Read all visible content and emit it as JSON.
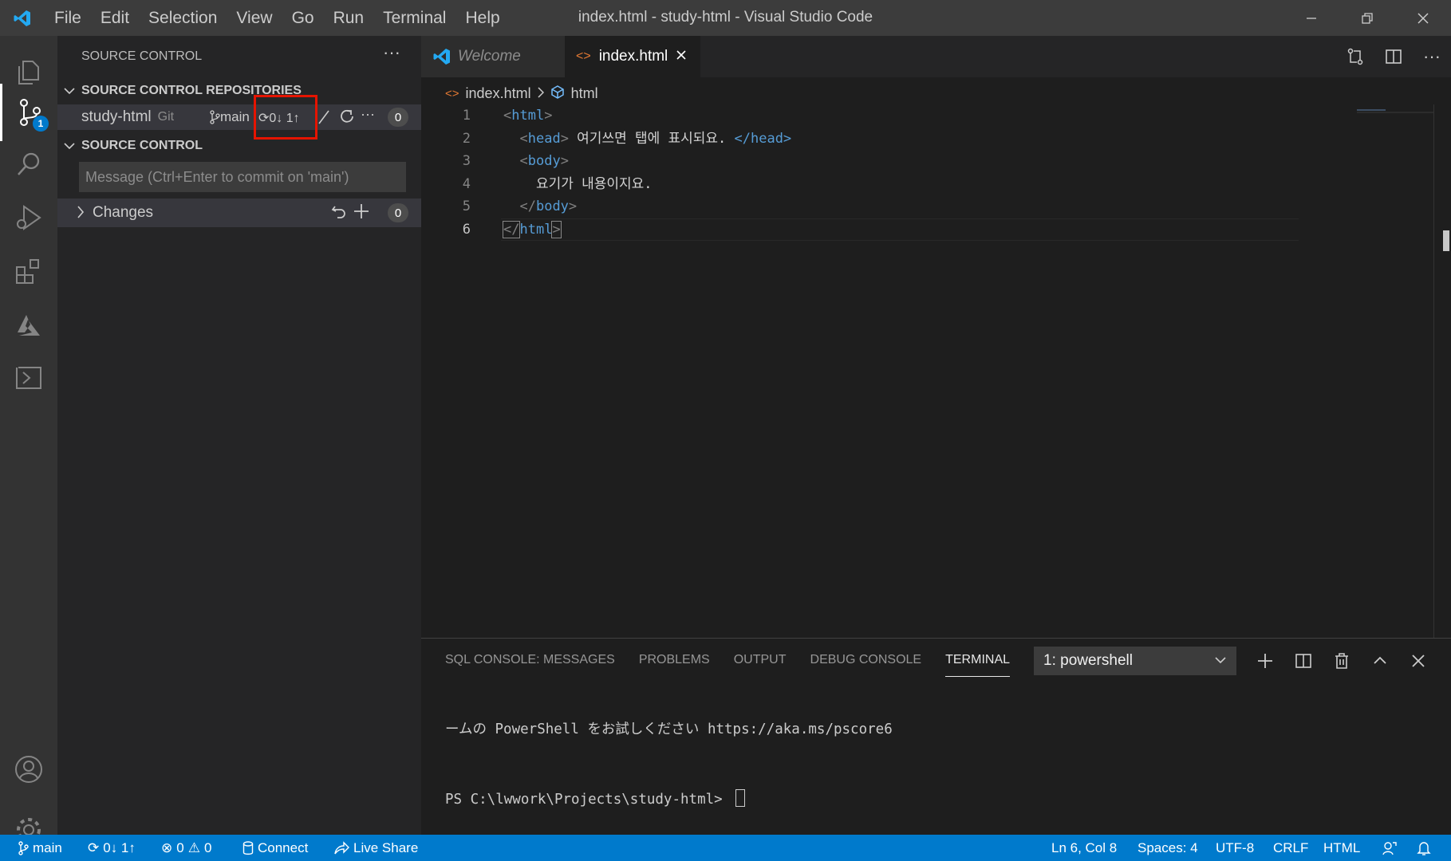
{
  "window": {
    "title": "index.html - study-html - Visual Studio Code",
    "menu": [
      "File",
      "Edit",
      "Selection",
      "View",
      "Go",
      "Run",
      "Terminal",
      "Help"
    ]
  },
  "activity_bar": {
    "scm_badge": "1"
  },
  "sidebar": {
    "header": "SOURCE CONTROL",
    "repos_section": "SOURCE CONTROL REPOSITORIES",
    "repo": {
      "name": "study-html",
      "kind": "Git",
      "branch": "main",
      "sync": "0↓ 1↑",
      "count": "0"
    },
    "scm_section": "SOURCE CONTROL",
    "commit_placeholder": "Message (Ctrl+Enter to commit on 'main')",
    "changes": {
      "label": "Changes",
      "count": "0"
    }
  },
  "editor": {
    "tabs": [
      {
        "label": "Welcome",
        "active": false
      },
      {
        "label": "index.html",
        "active": true
      }
    ],
    "breadcrumb": {
      "file": "index.html",
      "symbol": "html"
    },
    "lines": [
      {
        "num": "1",
        "indent": "",
        "open": "<",
        "tag": "html",
        "close": ">",
        "text": "",
        "endtag": ""
      },
      {
        "num": "2",
        "indent": "  ",
        "open": "<",
        "tag": "head",
        "close": ">",
        "text": " 여기쓰면 탭에 표시되요. ",
        "endtag": "</head>"
      },
      {
        "num": "3",
        "indent": "  ",
        "open": "<",
        "tag": "body",
        "close": ">",
        "text": "",
        "endtag": ""
      },
      {
        "num": "4",
        "indent": "    ",
        "open": "",
        "tag": "",
        "close": "",
        "text": "요기가 내용이지요.",
        "endtag": ""
      },
      {
        "num": "5",
        "indent": "  ",
        "open": "</",
        "tag": "body",
        "close": ">",
        "text": "",
        "endtag": ""
      },
      {
        "num": "6",
        "indent": "",
        "open": "</",
        "tag": "html",
        "close": ">",
        "text": "",
        "endtag": ""
      }
    ]
  },
  "panel": {
    "tabs": [
      "SQL CONSOLE: MESSAGES",
      "PROBLEMS",
      "OUTPUT",
      "DEBUG CONSOLE",
      "TERMINAL"
    ],
    "active_tab": "TERMINAL",
    "terminal_select": "1: powershell",
    "terminal_lines": [
      "ームの PowerShell をお試しください https://aka.ms/pscore6",
      "PS C:\\lwwork\\Projects\\study-html> "
    ]
  },
  "status_bar": {
    "branch": "main",
    "sync": "0↓ 1↑",
    "errors": "0",
    "warnings": "0",
    "connect": "Connect",
    "live_share": "Live Share",
    "position": "Ln 6, Col 8",
    "spaces": "Spaces: 4",
    "encoding": "UTF-8",
    "eol": "CRLF",
    "language": "HTML"
  },
  "colors": {
    "accent": "#007acc",
    "highlight": "#e51400",
    "tag": "#569cd6"
  }
}
